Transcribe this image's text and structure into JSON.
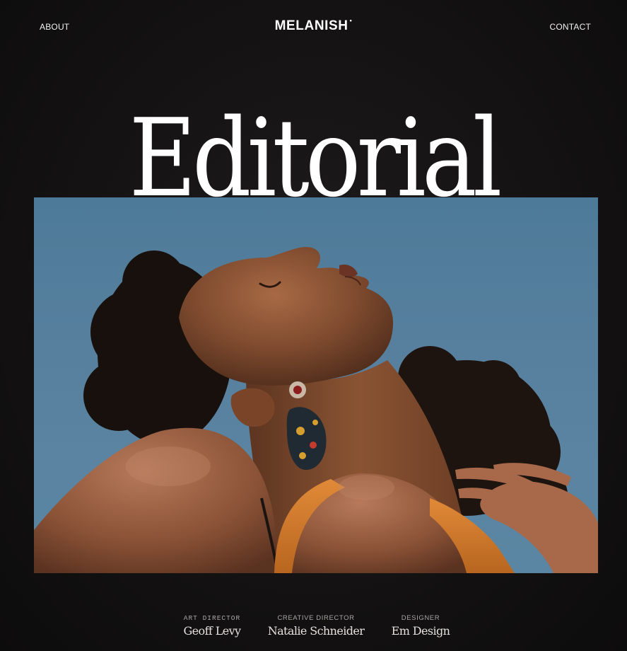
{
  "nav": {
    "about_label": "ABOUT",
    "contact_label": "CONTACT"
  },
  "brand": {
    "name": "MELANISH",
    "mark": "•"
  },
  "hero": {
    "title": "Editorial"
  },
  "credits": [
    {
      "role": "ART DIRECTOR",
      "name": "Geoff Levy"
    },
    {
      "role": "CREATIVE DIRECTOR",
      "name": "Natalie Schneider"
    },
    {
      "role": "DESIGNER",
      "name": "Em Design"
    }
  ],
  "colors": {
    "background": "#111010",
    "sky": "#557f9d",
    "skin": "#8a5233",
    "top": "#d17a2c",
    "text": "#ffffff"
  }
}
